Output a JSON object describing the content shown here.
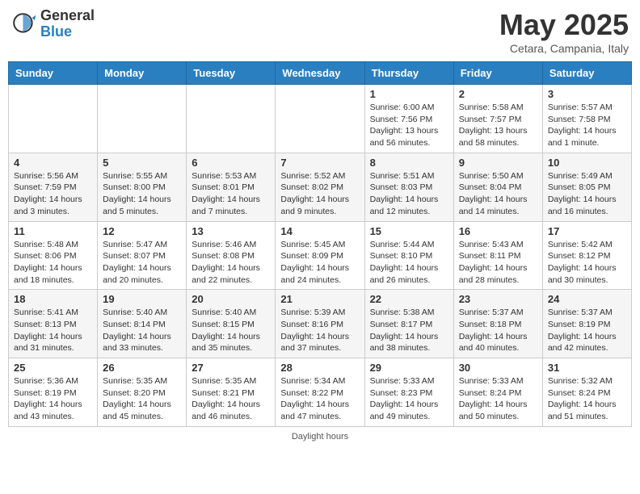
{
  "header": {
    "logo_general": "General",
    "logo_blue": "Blue",
    "month_title": "May 2025",
    "subtitle": "Cetara, Campania, Italy"
  },
  "days_of_week": [
    "Sunday",
    "Monday",
    "Tuesday",
    "Wednesday",
    "Thursday",
    "Friday",
    "Saturday"
  ],
  "weeks": [
    [
      {
        "day": "",
        "info": ""
      },
      {
        "day": "",
        "info": ""
      },
      {
        "day": "",
        "info": ""
      },
      {
        "day": "",
        "info": ""
      },
      {
        "day": "1",
        "sunrise": "6:00 AM",
        "sunset": "7:56 PM",
        "daylight": "13 hours and 56 minutes."
      },
      {
        "day": "2",
        "sunrise": "5:58 AM",
        "sunset": "7:57 PM",
        "daylight": "13 hours and 58 minutes."
      },
      {
        "day": "3",
        "sunrise": "5:57 AM",
        "sunset": "7:58 PM",
        "daylight": "14 hours and 1 minute."
      }
    ],
    [
      {
        "day": "4",
        "sunrise": "5:56 AM",
        "sunset": "7:59 PM",
        "daylight": "14 hours and 3 minutes."
      },
      {
        "day": "5",
        "sunrise": "5:55 AM",
        "sunset": "8:00 PM",
        "daylight": "14 hours and 5 minutes."
      },
      {
        "day": "6",
        "sunrise": "5:53 AM",
        "sunset": "8:01 PM",
        "daylight": "14 hours and 7 minutes."
      },
      {
        "day": "7",
        "sunrise": "5:52 AM",
        "sunset": "8:02 PM",
        "daylight": "14 hours and 9 minutes."
      },
      {
        "day": "8",
        "sunrise": "5:51 AM",
        "sunset": "8:03 PM",
        "daylight": "14 hours and 12 minutes."
      },
      {
        "day": "9",
        "sunrise": "5:50 AM",
        "sunset": "8:04 PM",
        "daylight": "14 hours and 14 minutes."
      },
      {
        "day": "10",
        "sunrise": "5:49 AM",
        "sunset": "8:05 PM",
        "daylight": "14 hours and 16 minutes."
      }
    ],
    [
      {
        "day": "11",
        "sunrise": "5:48 AM",
        "sunset": "8:06 PM",
        "daylight": "14 hours and 18 minutes."
      },
      {
        "day": "12",
        "sunrise": "5:47 AM",
        "sunset": "8:07 PM",
        "daylight": "14 hours and 20 minutes."
      },
      {
        "day": "13",
        "sunrise": "5:46 AM",
        "sunset": "8:08 PM",
        "daylight": "14 hours and 22 minutes."
      },
      {
        "day": "14",
        "sunrise": "5:45 AM",
        "sunset": "8:09 PM",
        "daylight": "14 hours and 24 minutes."
      },
      {
        "day": "15",
        "sunrise": "5:44 AM",
        "sunset": "8:10 PM",
        "daylight": "14 hours and 26 minutes."
      },
      {
        "day": "16",
        "sunrise": "5:43 AM",
        "sunset": "8:11 PM",
        "daylight": "14 hours and 28 minutes."
      },
      {
        "day": "17",
        "sunrise": "5:42 AM",
        "sunset": "8:12 PM",
        "daylight": "14 hours and 30 minutes."
      }
    ],
    [
      {
        "day": "18",
        "sunrise": "5:41 AM",
        "sunset": "8:13 PM",
        "daylight": "14 hours and 31 minutes."
      },
      {
        "day": "19",
        "sunrise": "5:40 AM",
        "sunset": "8:14 PM",
        "daylight": "14 hours and 33 minutes."
      },
      {
        "day": "20",
        "sunrise": "5:40 AM",
        "sunset": "8:15 PM",
        "daylight": "14 hours and 35 minutes."
      },
      {
        "day": "21",
        "sunrise": "5:39 AM",
        "sunset": "8:16 PM",
        "daylight": "14 hours and 37 minutes."
      },
      {
        "day": "22",
        "sunrise": "5:38 AM",
        "sunset": "8:17 PM",
        "daylight": "14 hours and 38 minutes."
      },
      {
        "day": "23",
        "sunrise": "5:37 AM",
        "sunset": "8:18 PM",
        "daylight": "14 hours and 40 minutes."
      },
      {
        "day": "24",
        "sunrise": "5:37 AM",
        "sunset": "8:19 PM",
        "daylight": "14 hours and 42 minutes."
      }
    ],
    [
      {
        "day": "25",
        "sunrise": "5:36 AM",
        "sunset": "8:19 PM",
        "daylight": "14 hours and 43 minutes."
      },
      {
        "day": "26",
        "sunrise": "5:35 AM",
        "sunset": "8:20 PM",
        "daylight": "14 hours and 45 minutes."
      },
      {
        "day": "27",
        "sunrise": "5:35 AM",
        "sunset": "8:21 PM",
        "daylight": "14 hours and 46 minutes."
      },
      {
        "day": "28",
        "sunrise": "5:34 AM",
        "sunset": "8:22 PM",
        "daylight": "14 hours and 47 minutes."
      },
      {
        "day": "29",
        "sunrise": "5:33 AM",
        "sunset": "8:23 PM",
        "daylight": "14 hours and 49 minutes."
      },
      {
        "day": "30",
        "sunrise": "5:33 AM",
        "sunset": "8:24 PM",
        "daylight": "14 hours and 50 minutes."
      },
      {
        "day": "31",
        "sunrise": "5:32 AM",
        "sunset": "8:24 PM",
        "daylight": "14 hours and 51 minutes."
      }
    ]
  ],
  "footer": {
    "daylight_label": "Daylight hours"
  },
  "labels": {
    "sunrise_prefix": "Sunrise: ",
    "sunset_prefix": "Sunset: ",
    "daylight_prefix": "Daylight: "
  }
}
